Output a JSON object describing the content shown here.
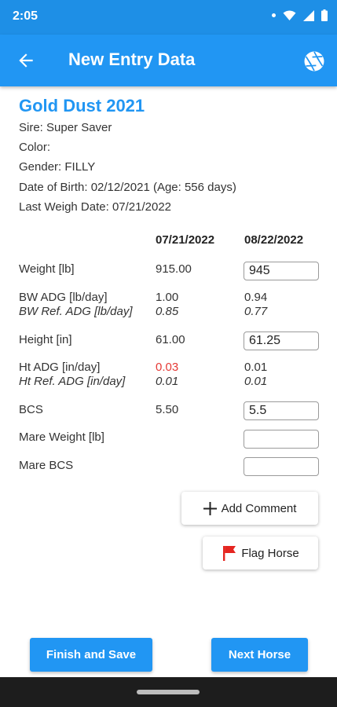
{
  "status_bar": {
    "time": "2:05"
  },
  "app_bar": {
    "title": "New Entry Data",
    "back_icon": "arrow-left-icon",
    "action_icon": "aperture-icon"
  },
  "horse": {
    "name": "Gold Dust 2021",
    "sire": "Sire: Super Saver",
    "color": "Color:",
    "gender": "Gender: FILLY",
    "dob": "Date of Birth: 02/12/2021 (Age: 556 days)",
    "last_weigh": "Last Weigh Date: 07/21/2022"
  },
  "table": {
    "col_prev": "07/21/2022",
    "col_new": "08/22/2022",
    "weight": {
      "label": "Weight [lb]",
      "prev": "915.00",
      "new": "945"
    },
    "bw_adg": {
      "label": "BW ADG [lb/day]",
      "prev": "1.00",
      "new": "0.94"
    },
    "bw_ref": {
      "label": "BW Ref. ADG [lb/day]",
      "prev": "0.85",
      "new": "0.77"
    },
    "height": {
      "label": "Height [in]",
      "prev": "61.00",
      "new": "61.25"
    },
    "ht_adg": {
      "label": "Ht ADG [in/day]",
      "prev": "0.03",
      "new": "0.01"
    },
    "ht_ref": {
      "label": "Ht Ref. ADG [in/day]",
      "prev": "0.01",
      "new": "0.01"
    },
    "bcs": {
      "label": "BCS",
      "prev": "5.50",
      "new": "5.5"
    },
    "mare_weight": {
      "label": "Mare Weight [lb]",
      "new": ""
    },
    "mare_bcs": {
      "label": "Mare BCS",
      "new": ""
    }
  },
  "actions": {
    "add_comment": "Add Comment",
    "flag_horse": "Flag Horse",
    "finish_save": "Finish and Save",
    "next_horse": "Next Horse"
  },
  "colors": {
    "primary": "#2196f3",
    "status_bar": "#1e8fe6",
    "alert": "#e53935",
    "flag": "#e52520"
  }
}
